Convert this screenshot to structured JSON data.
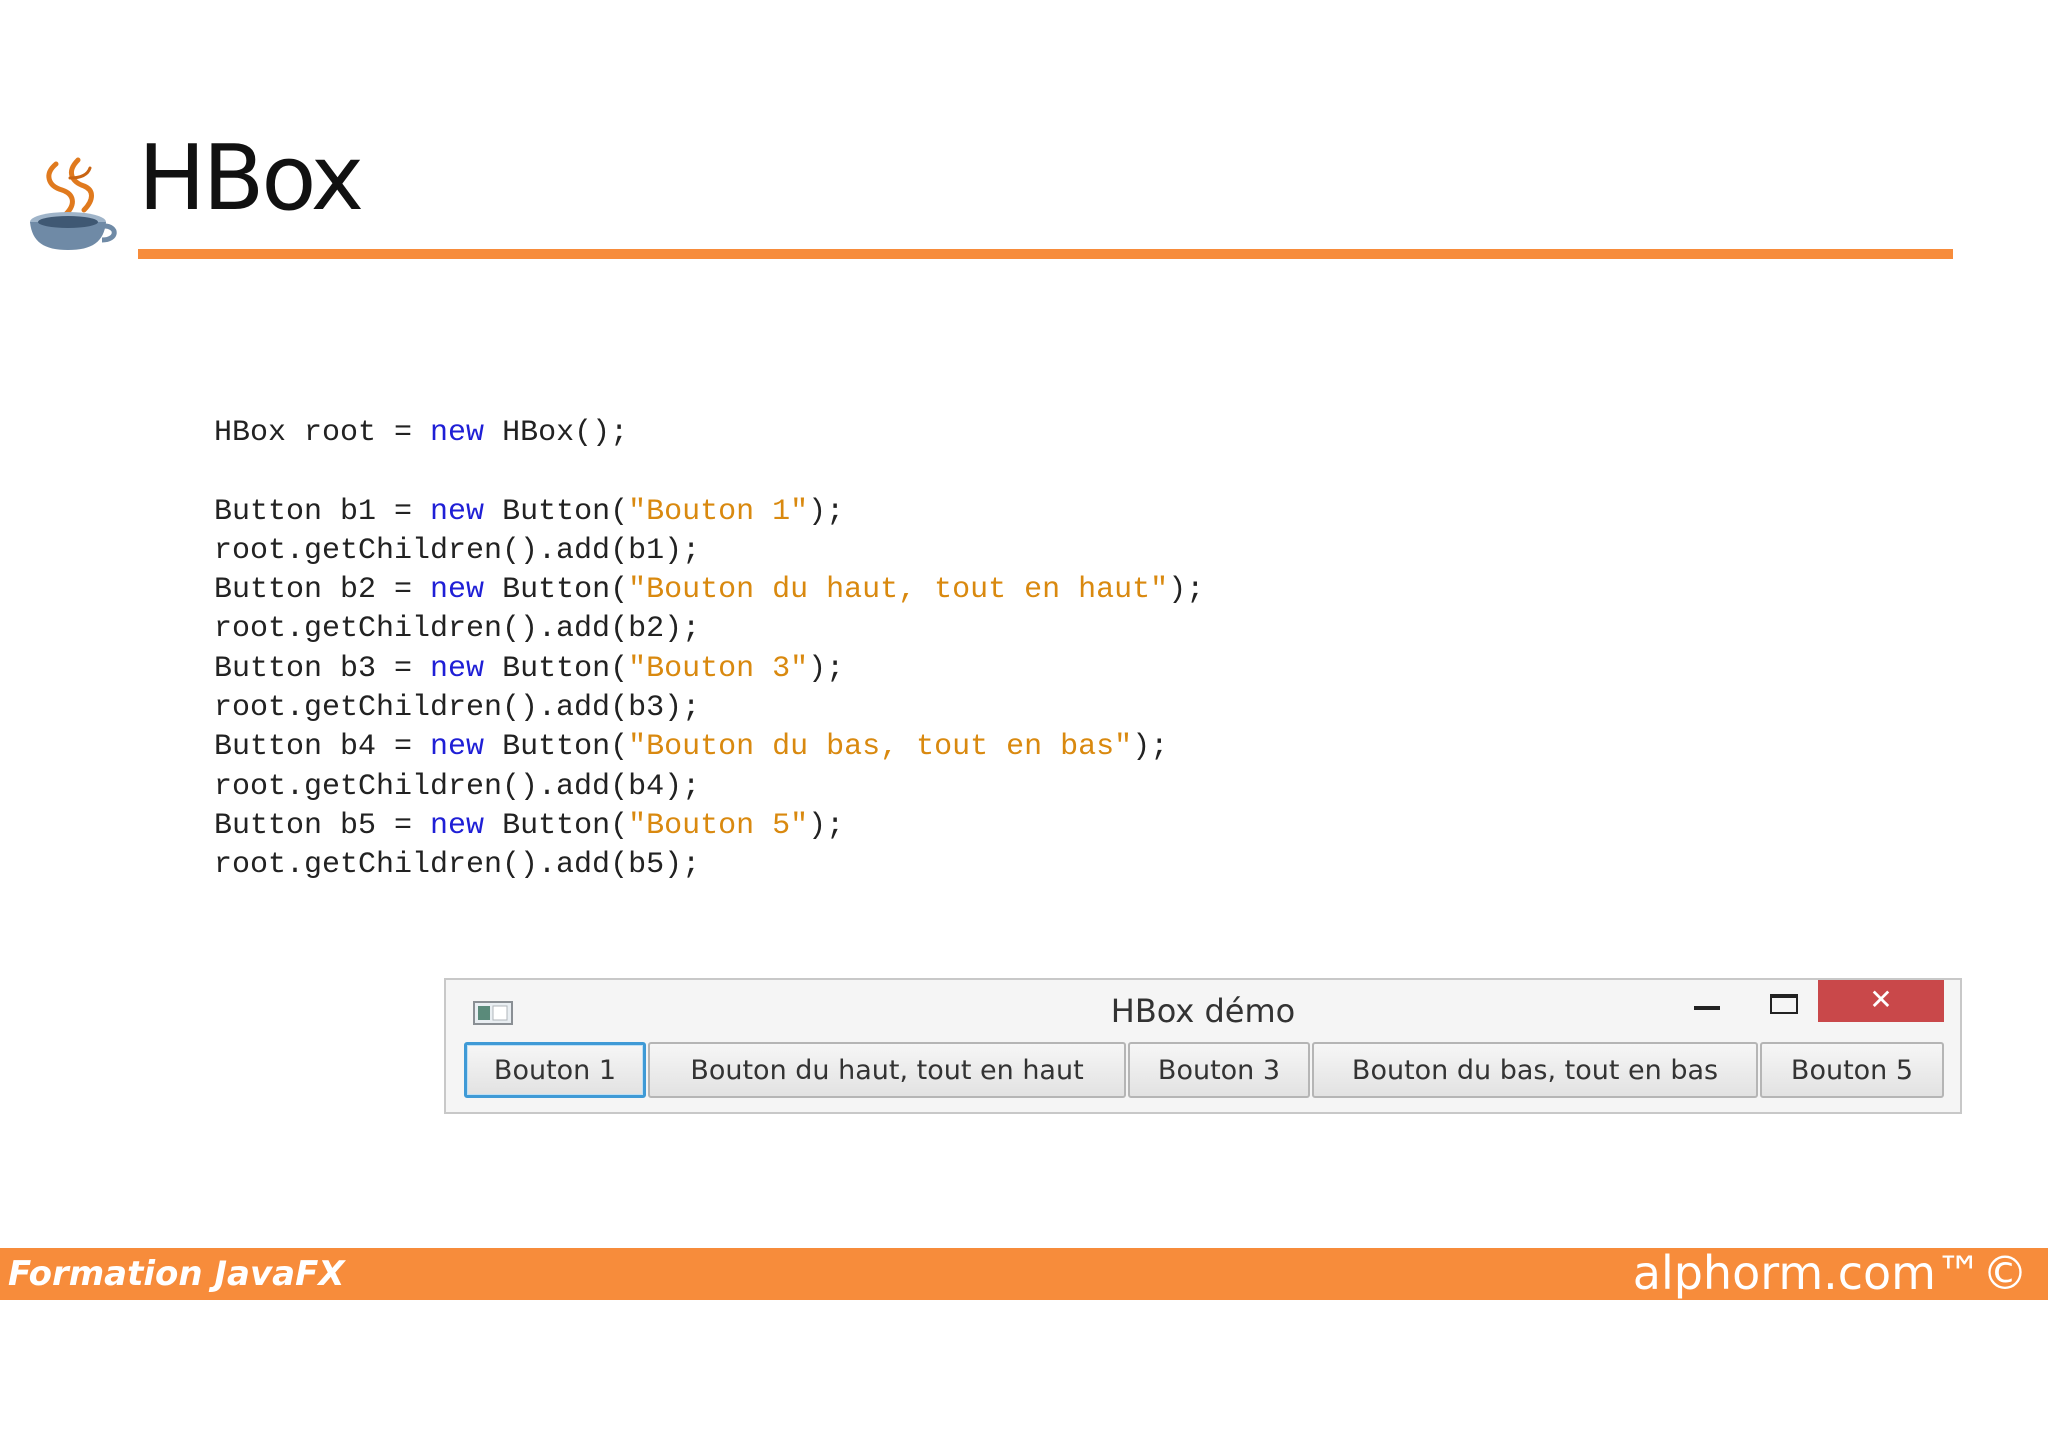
{
  "slide": {
    "title": "HBox",
    "logo_icon": "javafx-coffee-cup-logo"
  },
  "code": {
    "lines": [
      [
        {
          "t": "HBox root = "
        },
        {
          "t": "new",
          "k": "kw"
        },
        {
          "t": " HBox();"
        }
      ],
      [],
      [
        {
          "t": "Button b1 = "
        },
        {
          "t": "new",
          "k": "kw"
        },
        {
          "t": " Button("
        },
        {
          "t": "\"Bouton 1\"",
          "k": "str"
        },
        {
          "t": ");"
        }
      ],
      [
        {
          "t": "root.getChildren().add(b1);"
        }
      ],
      [
        {
          "t": "Button b2 = "
        },
        {
          "t": "new",
          "k": "kw"
        },
        {
          "t": " Button("
        },
        {
          "t": "\"Bouton du haut, tout en haut\"",
          "k": "str"
        },
        {
          "t": ");"
        }
      ],
      [
        {
          "t": "root.getChildren().add(b2);"
        }
      ],
      [
        {
          "t": "Button b3 = "
        },
        {
          "t": "new",
          "k": "kw"
        },
        {
          "t": " Button("
        },
        {
          "t": "\"Bouton 3\"",
          "k": "str"
        },
        {
          "t": ");"
        }
      ],
      [
        {
          "t": "root.getChildren().add(b3);"
        }
      ],
      [
        {
          "t": "Button b4 = "
        },
        {
          "t": "new",
          "k": "kw"
        },
        {
          "t": " Button("
        },
        {
          "t": "\"Bouton du bas, tout en bas\"",
          "k": "str"
        },
        {
          "t": ");"
        }
      ],
      [
        {
          "t": "root.getChildren().add(b4);"
        }
      ],
      [
        {
          "t": "Button b5 = "
        },
        {
          "t": "new",
          "k": "kw"
        },
        {
          "t": " Button("
        },
        {
          "t": "\"Bouton 5\"",
          "k": "str"
        },
        {
          "t": ");"
        }
      ],
      [
        {
          "t": "root.getChildren().add(b5);"
        }
      ]
    ]
  },
  "window": {
    "title": "HBox démo",
    "close_symbol": "✕",
    "buttons": [
      {
        "label": "Bouton 1",
        "focused": true
      },
      {
        "label": "Bouton du haut, tout en haut",
        "focused": false
      },
      {
        "label": "Bouton 3",
        "focused": false
      },
      {
        "label": "Bouton du bas, tout en bas",
        "focused": false
      },
      {
        "label": "Bouton 5",
        "focused": false
      }
    ]
  },
  "footer": {
    "left": "Formation JavaFX",
    "right": "alphorm.com™©"
  },
  "colors": {
    "accent_orange": "#f78c3b",
    "keyword_blue": "#1f1fd6",
    "string_orange": "#d9890f",
    "close_red": "#c9484a",
    "focus_blue": "#3f9ad6"
  }
}
